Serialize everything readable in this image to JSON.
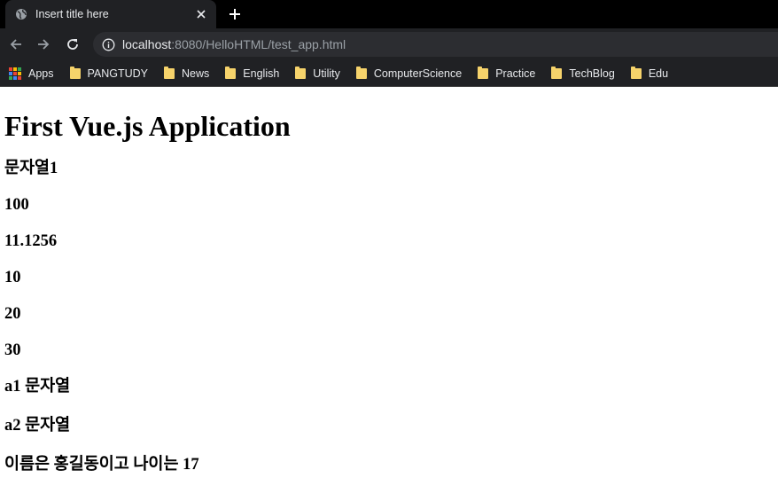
{
  "browser": {
    "tab_title": "Insert title here",
    "url_host": "localhost",
    "url_rest": ":8080/HelloHTML/test_app.html",
    "bookmarks": [
      {
        "label": "Apps",
        "icon": "apps-grid-icon"
      },
      {
        "label": "PANGTUDY",
        "icon": "folder-icon"
      },
      {
        "label": "News",
        "icon": "folder-icon"
      },
      {
        "label": "English",
        "icon": "folder-icon"
      },
      {
        "label": "Utility",
        "icon": "folder-icon"
      },
      {
        "label": "ComputerScience",
        "icon": "folder-icon"
      },
      {
        "label": "Practice",
        "icon": "folder-icon"
      },
      {
        "label": "TechBlog",
        "icon": "folder-icon"
      },
      {
        "label": "Edu",
        "icon": "folder-icon"
      }
    ]
  },
  "page": {
    "heading": "First Vue.js Application",
    "lines": [
      "문자열1",
      "100",
      "11.1256",
      "10",
      "20",
      "30",
      "a1 문자열",
      "a2 문자열",
      "이름은 홍길동이고 나이는 17"
    ]
  },
  "colors": {
    "chrome_dark": "#202124",
    "tab_strip": "#000000",
    "folder": "#f6d36b"
  }
}
